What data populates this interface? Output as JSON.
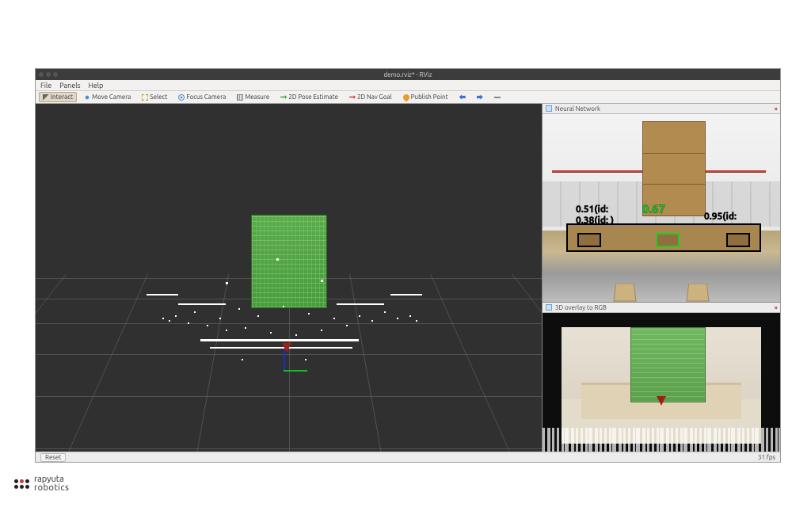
{
  "window": {
    "title": "demo.rviz* - RViz"
  },
  "menubar": {
    "items": [
      "File",
      "Panels",
      "Help"
    ]
  },
  "toolbar": {
    "interact": "Interact",
    "move_camera": "Move Camera",
    "select": "Select",
    "focus_camera": "Focus Camera",
    "measure": "Measure",
    "pose_estimate": "2D Pose Estimate",
    "nav_goal": "2D Nav Goal",
    "publish_point": "Publish Point"
  },
  "panels": {
    "neural_network": {
      "title": "Neural Network"
    },
    "overlay_3d": {
      "title": "3D overlay to RGB"
    }
  },
  "detections": {
    "d1": "0.51(id:",
    "d2": "0.67",
    "d3": "0.38(id:  )",
    "d4": "0.95(id:"
  },
  "statusbar": {
    "reset": "Reset",
    "fps": "31 fps"
  },
  "branding": {
    "line1": "rapyuta",
    "line2": "robotics"
  }
}
